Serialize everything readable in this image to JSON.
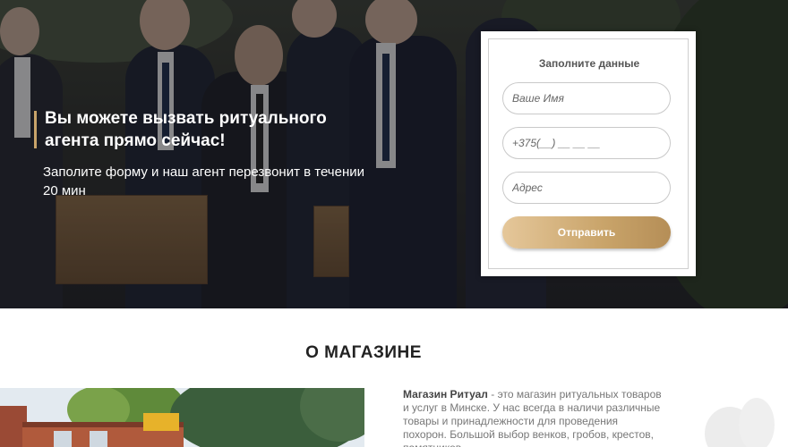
{
  "hero": {
    "title": "Вы можете вызвать ритуального агента прямо сейчас!",
    "subtitle": "Заполите форму и наш агент перезвонит в течении 20 мин"
  },
  "form": {
    "title": "Заполните данные",
    "name_placeholder": "Ваше Имя",
    "phone_placeholder": "+375(__) __ __ __",
    "address_placeholder": "Адрес",
    "submit_label": "Отправить"
  },
  "about": {
    "title": "О МАГАЗИНЕ",
    "store_name": "Магазин Ритуал",
    "text": " - это магазин ритуальных товаров и услуг в Минске. У нас всегда в наличи различные товары и принадлежности для проведения похорон. Большой выбор венков, гробов, крестов, памятников"
  },
  "colors": {
    "accent": "#c9a46a",
    "button_gradient_start": "#e5c79a",
    "button_gradient_end": "#b58e57"
  }
}
